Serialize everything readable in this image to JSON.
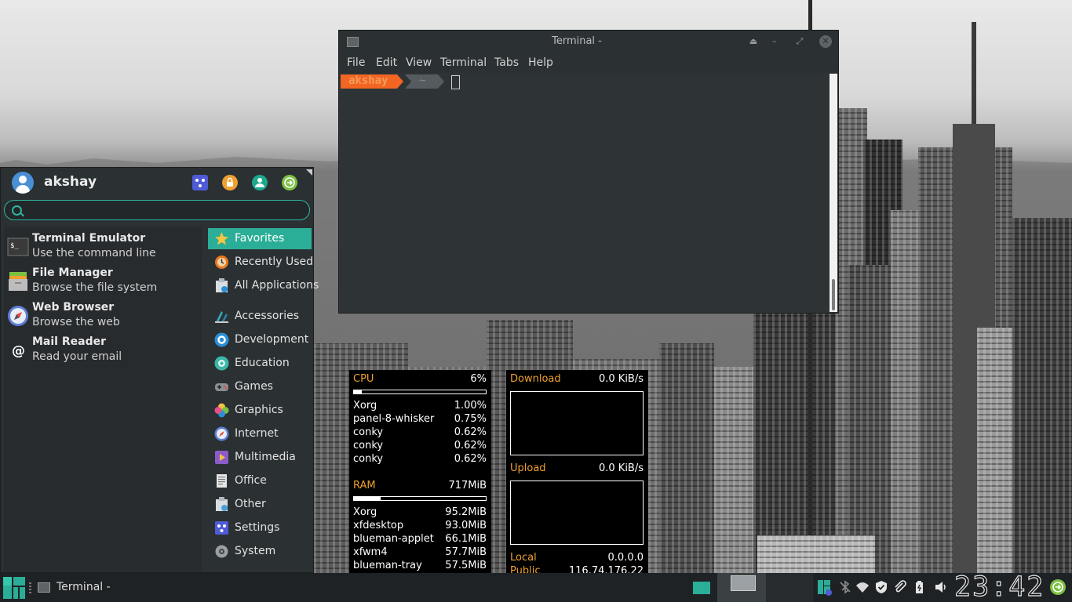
{
  "whisker": {
    "username": "akshay",
    "search_placeholder": "",
    "favorites": [
      {
        "title": "Terminal Emulator",
        "subtitle": "Use the command line",
        "icon": "terminal-icon"
      },
      {
        "title": "File Manager",
        "subtitle": "Browse the file system",
        "icon": "folder-icon"
      },
      {
        "title": "Web Browser",
        "subtitle": "Browse the web",
        "icon": "compass-icon"
      },
      {
        "title": "Mail Reader",
        "subtitle": "Read your email",
        "icon": "at-sign-icon"
      }
    ],
    "categories": [
      {
        "label": "Favorites",
        "icon": "star-icon",
        "color": "#f4c542",
        "active": true
      },
      {
        "label": "Recently Used",
        "icon": "history-icon",
        "color": "#e8781c"
      },
      {
        "label": "All Applications",
        "icon": "applications-icon",
        "color": "#9fb8c9"
      },
      {
        "label": "Accessories",
        "icon": "accessories-icon",
        "color": "#3aa6b9"
      },
      {
        "label": "Development",
        "icon": "development-icon",
        "color": "#2a8fd6"
      },
      {
        "label": "Education",
        "icon": "education-icon",
        "color": "#3bb7a8"
      },
      {
        "label": "Games",
        "icon": "gamepad-icon",
        "color": "#8a8f93"
      },
      {
        "label": "Graphics",
        "icon": "graphics-icon",
        "color": "#e84f8a"
      },
      {
        "label": "Internet",
        "icon": "internet-icon",
        "color": "#5d7fd6"
      },
      {
        "label": "Multimedia",
        "icon": "multimedia-icon",
        "color": "#8b5cc7"
      },
      {
        "label": "Office",
        "icon": "office-icon",
        "color": "#dcdcdc"
      },
      {
        "label": "Other",
        "icon": "other-icon",
        "color": "#4aa0d8"
      },
      {
        "label": "Settings",
        "icon": "settings-icon",
        "color": "#4f5bd5"
      },
      {
        "label": "System",
        "icon": "system-icon",
        "color": "#9aa0a6"
      }
    ],
    "header_buttons": [
      {
        "icon": "settings-manager-icon",
        "color": "#4f5bd5"
      },
      {
        "icon": "lock-screen-icon",
        "color": "#f0a030"
      },
      {
        "icon": "switch-user-icon",
        "color": "#1ba88d"
      },
      {
        "icon": "logout-icon",
        "color": "#7cc043"
      }
    ]
  },
  "terminal": {
    "title": "Terminal -",
    "menu": [
      "File",
      "Edit",
      "View",
      "Terminal",
      "Tabs",
      "Help"
    ],
    "prompt_user": "akshay",
    "prompt_dir": "~"
  },
  "conky": {
    "cpu_label": "CPU",
    "cpu_value": "6%",
    "cpu_usage": 0.06,
    "cpu_processes": [
      {
        "name": "Xorg",
        "value": "1.00%"
      },
      {
        "name": "panel-8-whisker",
        "value": "0.75%"
      },
      {
        "name": "conky",
        "value": "0.62%"
      },
      {
        "name": "conky",
        "value": "0.62%"
      },
      {
        "name": "conky",
        "value": "0.62%"
      }
    ],
    "ram_label": "RAM",
    "ram_value": "717MiB",
    "ram_usage": 0.2,
    "ram_processes": [
      {
        "name": "Xorg",
        "value": "95.2MiB"
      },
      {
        "name": "xfdesktop",
        "value": "93.0MiB"
      },
      {
        "name": "blueman-applet",
        "value": "66.1MiB"
      },
      {
        "name": "xfwm4",
        "value": "57.7MiB"
      },
      {
        "name": "blueman-tray",
        "value": "57.5MiB"
      }
    ],
    "download_label": "Download",
    "download_value": "0.0 KiB/s",
    "upload_label": "Upload",
    "upload_value": "0.0 KiB/s",
    "local_label": "Local",
    "local_value": "0.0.0.0",
    "public_label": "Public",
    "public_value": "116.74.176.22"
  },
  "taskbar": {
    "task_label": "Terminal -",
    "clock": "23:42"
  },
  "colors": {
    "accent": "#2bae97",
    "orange": "#f0a030",
    "prompt_orange": "#f26522"
  }
}
